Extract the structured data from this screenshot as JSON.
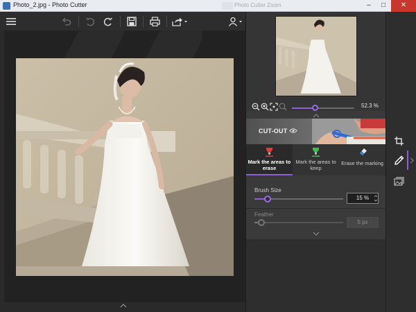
{
  "window": {
    "title": "Photo_2.jpg - Photo Cutter",
    "background_tab": "Photo Cutter Zoom",
    "minimize": "–",
    "maximize": "□",
    "close": "✕"
  },
  "toolbar": {
    "menu_icon": "hamburger-icon",
    "undo_all_icon": "undo-all-icon",
    "undo_icon": "undo-icon",
    "redo_icon": "redo-icon",
    "save_icon": "save-icon",
    "print_icon": "print-icon",
    "share_icon": "share-icon",
    "user_icon": "user-icon"
  },
  "navigator": {
    "zoom_percent": "52.3 %",
    "zoom_level": 0.37,
    "zoom_out_icon": "zoom-out-icon",
    "zoom_in_icon": "zoom-in-icon",
    "fit_icon": "fit-icon",
    "actual_size_icon": "actual-size-icon"
  },
  "cutout": {
    "label": "CUT-OUT",
    "tag_icon": "eye-icon"
  },
  "tabs": [
    {
      "label": "Mark the areas to erase",
      "icon": "red-marker-icon",
      "active": true
    },
    {
      "label": "Mark the areas to keep",
      "icon": "green-marker-icon",
      "active": false
    },
    {
      "label": "Erase the marking",
      "icon": "eraser-icon",
      "active": false
    }
  ],
  "brush_size": {
    "label": "Brush Size",
    "value": "15 %",
    "level": 0.15
  },
  "feather": {
    "label": "Feather",
    "value": "5 px",
    "level": 0.08,
    "enabled": false
  },
  "sidebar": {
    "crop_icon": "crop-icon",
    "brush_icon": "brush-icon",
    "background_icon": "background-image-icon"
  },
  "colors": {
    "accent": "#8e5fd8",
    "panel": "#3a3a3a",
    "canvas": "#222222"
  }
}
